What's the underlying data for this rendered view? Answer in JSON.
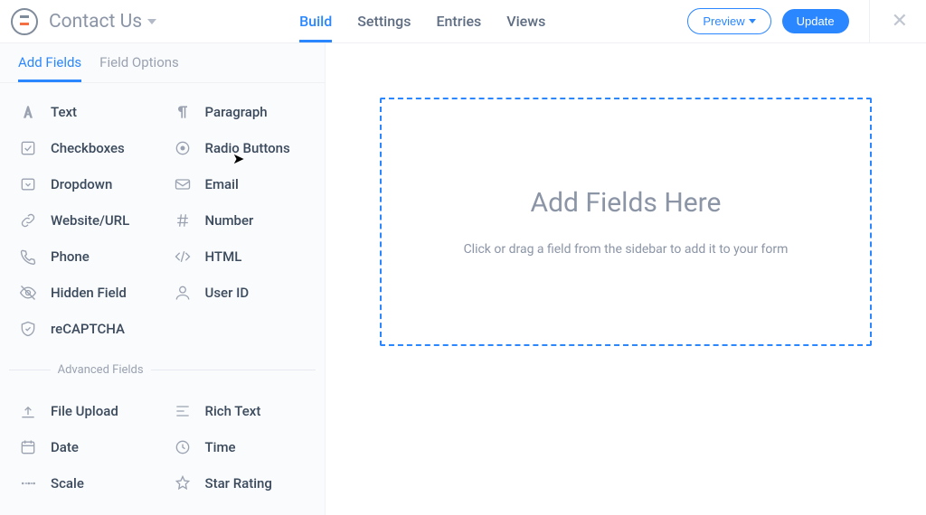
{
  "header": {
    "form_title": "Contact Us",
    "nav": {
      "build": "Build",
      "settings": "Settings",
      "entries": "Entries",
      "views": "Views"
    },
    "preview": "Preview",
    "update": "Update"
  },
  "sidebar": {
    "tabs": {
      "add_fields": "Add Fields",
      "field_options": "Field Options"
    },
    "basic": {
      "text": "Text",
      "paragraph": "Paragraph",
      "checkboxes": "Checkboxes",
      "radio": "Radio Buttons",
      "dropdown": "Dropdown",
      "email": "Email",
      "website": "Website/URL",
      "number": "Number",
      "phone": "Phone",
      "html": "HTML",
      "hidden": "Hidden Field",
      "userid": "User ID",
      "recaptcha": "reCAPTCHA"
    },
    "advanced_label": "Advanced Fields",
    "advanced": {
      "file": "File Upload",
      "richtext": "Rich Text",
      "date": "Date",
      "time": "Time",
      "scale": "Scale",
      "star": "Star Rating"
    }
  },
  "canvas": {
    "title": "Add Fields Here",
    "hint": "Click or drag a field from the sidebar to add it to your form"
  }
}
